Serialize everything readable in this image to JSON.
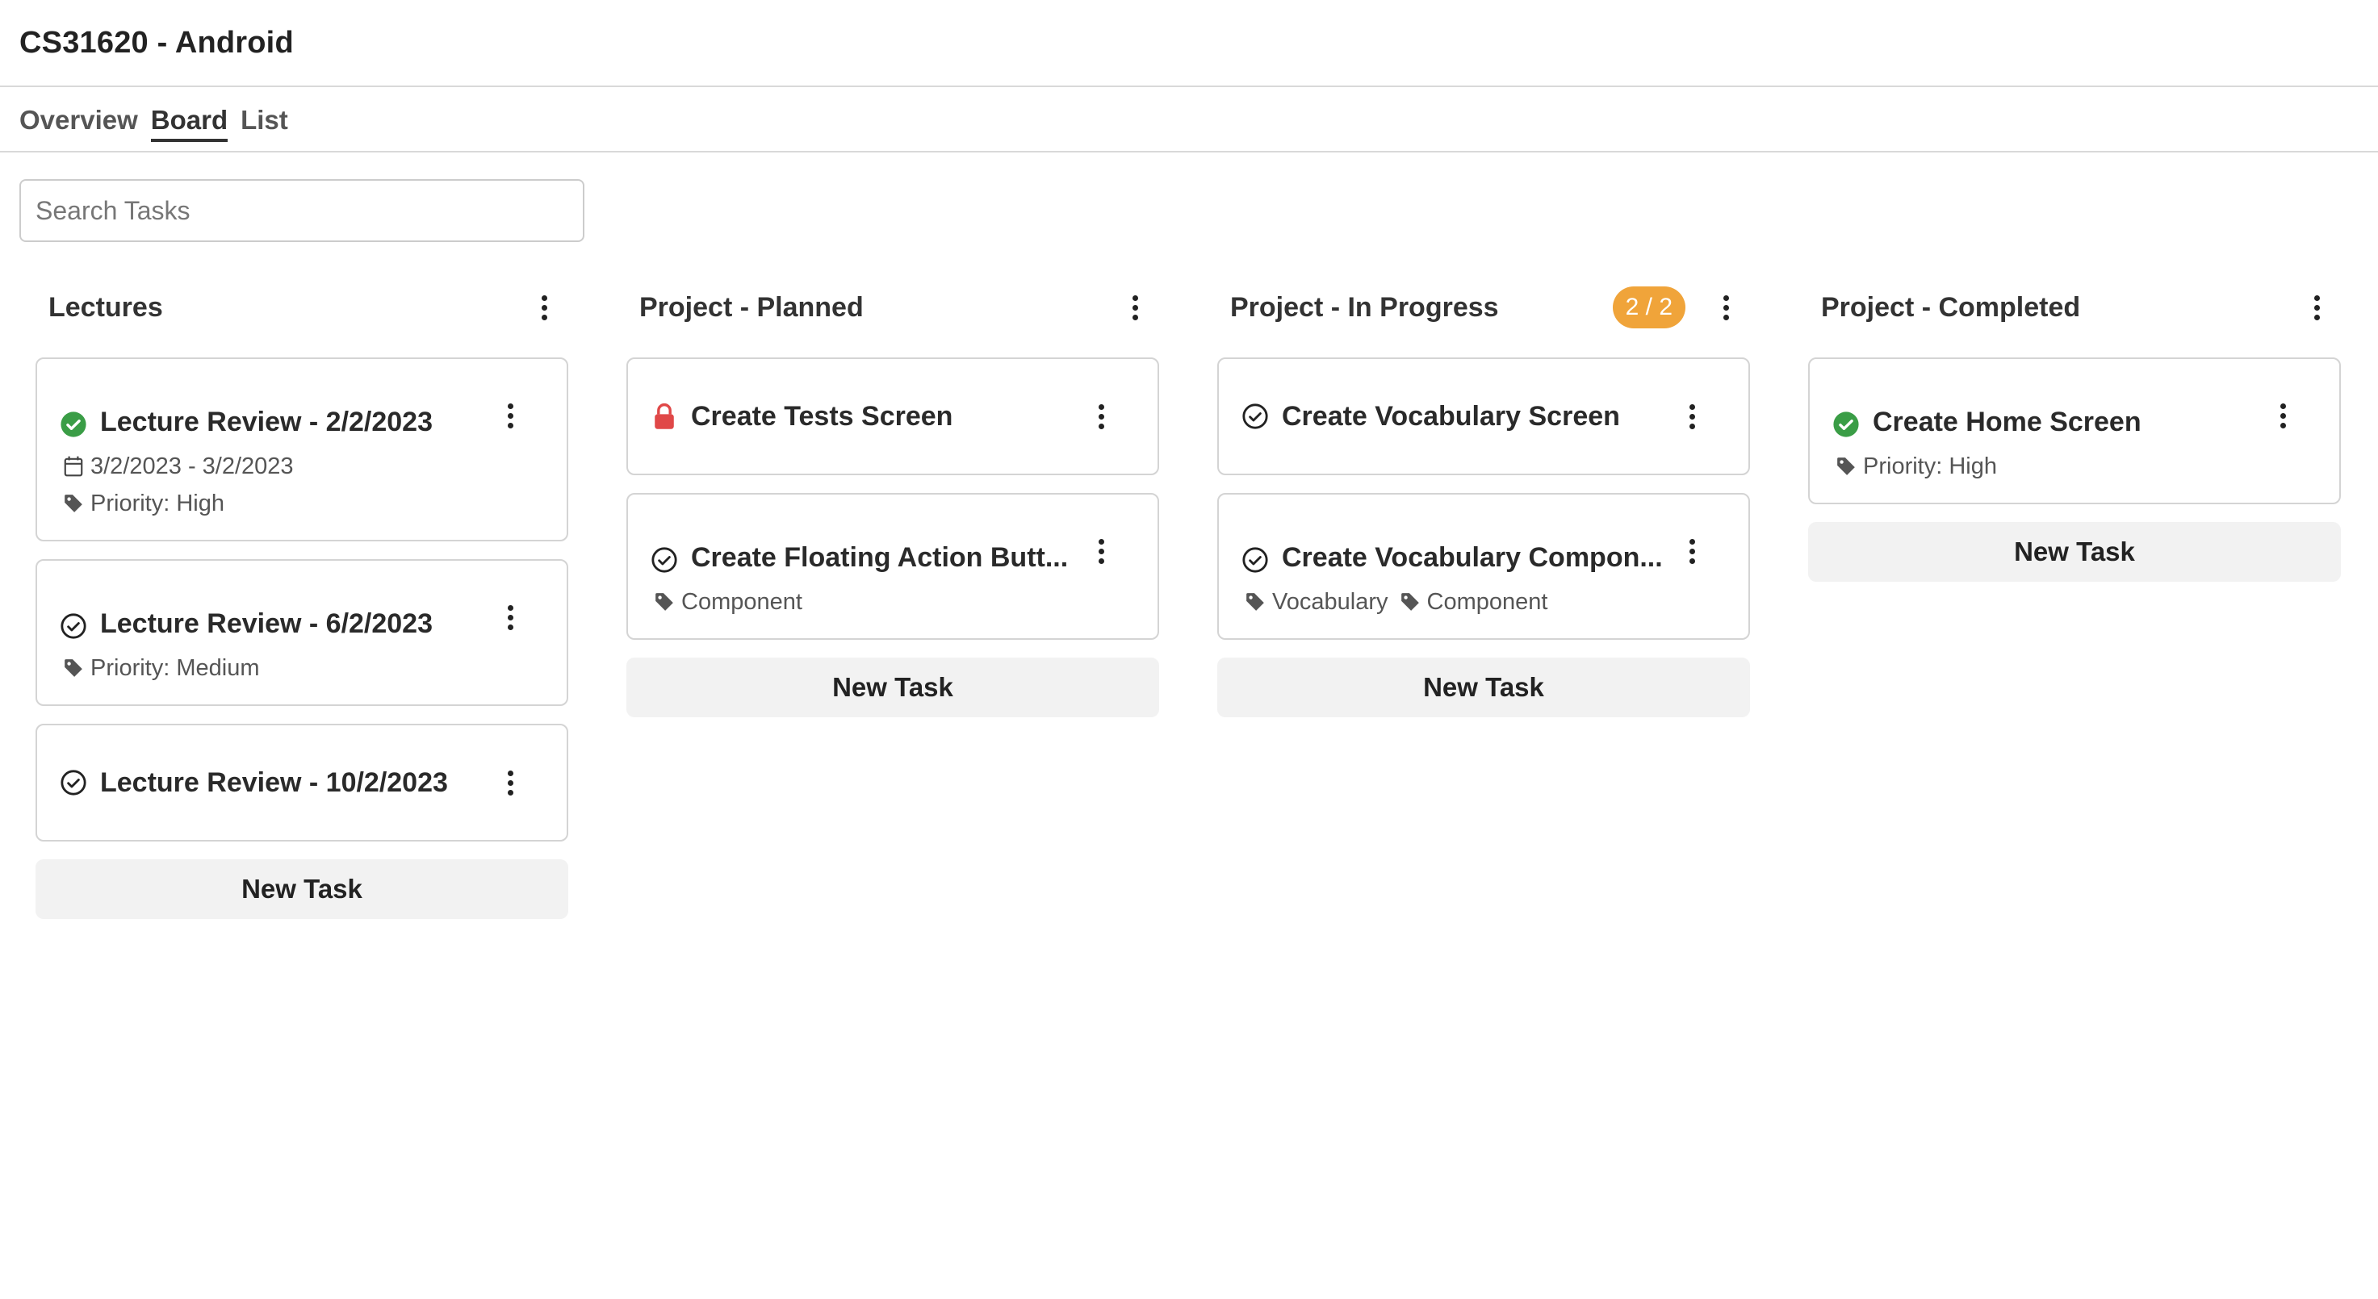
{
  "app": {
    "title": "CS31620 - Android"
  },
  "tabs": [
    {
      "label": "Overview",
      "active": false
    },
    {
      "label": "Board",
      "active": true
    },
    {
      "label": "List",
      "active": false
    }
  ],
  "search": {
    "placeholder": "Search Tasks",
    "value": ""
  },
  "colors": {
    "accent_badge": "#f0a43a",
    "done_green": "#3a9d46",
    "lock_red": "#e04848",
    "button_bg": "#f2f2f2"
  },
  "columns": [
    {
      "title": "Lectures",
      "badge": null,
      "new_task_label": "New Task",
      "cards": [
        {
          "title": "Lecture Review - 2/2/2023",
          "status_icon": "check-circle-filled-icon",
          "date_range": "3/2/2023 - 3/2/2023",
          "tags": [
            "Priority: High"
          ]
        },
        {
          "title": "Lecture Review - 6/2/2023",
          "status_icon": "check-circle-outline-icon",
          "tags": [
            "Priority: Medium"
          ]
        },
        {
          "title": "Lecture Review - 10/2/2023",
          "status_icon": "check-circle-outline-icon",
          "tags": []
        }
      ]
    },
    {
      "title": "Project - Planned",
      "badge": null,
      "new_task_label": "New Task",
      "cards": [
        {
          "title": "Create Tests Screen",
          "status_icon": "lock-icon",
          "tags": []
        },
        {
          "title": "Create Floating Action Butt...",
          "status_icon": "check-circle-outline-icon",
          "tags": [
            "Component"
          ]
        }
      ]
    },
    {
      "title": "Project - In Progress",
      "badge": "2 / 2",
      "new_task_label": "New Task",
      "cards": [
        {
          "title": "Create Vocabulary Screen",
          "status_icon": "check-circle-outline-icon",
          "tags": []
        },
        {
          "title": "Create Vocabulary Compon...",
          "status_icon": "check-circle-outline-icon",
          "tags": [
            "Vocabulary",
            "Component"
          ]
        }
      ]
    },
    {
      "title": "Project - Completed",
      "badge": null,
      "new_task_label": "New Task",
      "cards": [
        {
          "title": "Create Home Screen",
          "status_icon": "check-circle-filled-icon",
          "tags": [
            "Priority: High"
          ]
        }
      ]
    }
  ]
}
